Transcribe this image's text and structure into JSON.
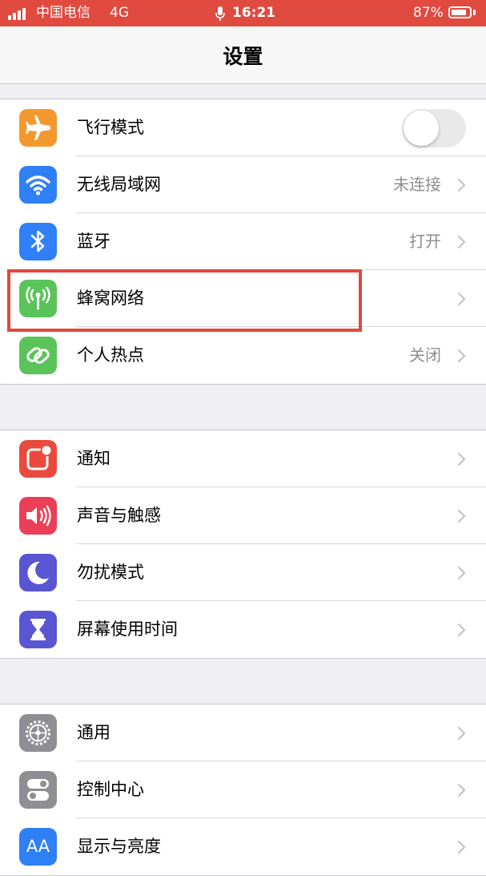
{
  "status_bar": {
    "carrier": "中国电信",
    "network": "4G",
    "time": "16:21",
    "battery_percent": "87%",
    "battery_level": 0.87,
    "background_color": "#e04a3f"
  },
  "nav": {
    "title": "设置"
  },
  "groups": [
    {
      "rows": [
        {
          "label": "飞行模式",
          "icon": "airplane-icon",
          "color": "#f3982f",
          "control": "toggle",
          "toggle_on": false
        },
        {
          "label": "无线局域网",
          "value": "未连接",
          "icon": "wifi-icon",
          "color": "#2f7ff6"
        },
        {
          "label": "蓝牙",
          "value": "打开",
          "icon": "bluetooth-icon",
          "color": "#2f7ff6"
        },
        {
          "label": "蜂窝网络",
          "icon": "cellular-antenna-icon",
          "color": "#5ac35a",
          "highlighted": true
        },
        {
          "label": "个人热点",
          "value": "关闭",
          "icon": "hotspot-chain-icon",
          "color": "#5ac35a"
        }
      ]
    },
    {
      "rows": [
        {
          "label": "通知",
          "icon": "notifications-icon",
          "color": "#e94a3d"
        },
        {
          "label": "声音与触感",
          "icon": "speaker-icon",
          "color": "#ea3f56"
        },
        {
          "label": "勿扰模式",
          "icon": "moon-icon",
          "color": "#5a55d3"
        },
        {
          "label": "屏幕使用时间",
          "icon": "hourglass-icon",
          "color": "#5a55d3"
        }
      ]
    },
    {
      "rows": [
        {
          "label": "通用",
          "icon": "gear-icon",
          "color": "#8e8e93"
        },
        {
          "label": "控制中心",
          "icon": "control-center-icon",
          "color": "#8e8e93"
        },
        {
          "label": "显示与亮度",
          "icon": "display-text-icon",
          "color": "#2f7ff6",
          "icon_text": "AA"
        }
      ]
    }
  ],
  "annotation": {
    "color": "#e2483d",
    "target": "蜂窝网络"
  }
}
